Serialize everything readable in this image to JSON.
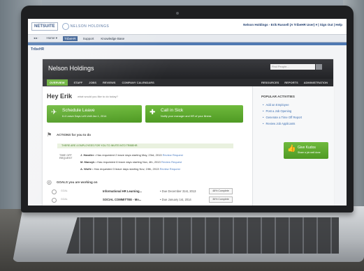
{
  "topbar": {
    "netsuite_logo": "NETSUITE",
    "company_logo": "NELSON HOLDINGS",
    "user_links": "Nelson Holdings - Erik Russell (A TribeHR User) ▾ | Sign Out | Help"
  },
  "navbar": {
    "items": [
      {
        "label": "◂ ▸ ·"
      },
      {
        "label": "Home ▾"
      },
      {
        "label": "TribeHR"
      },
      {
        "label": "Support"
      },
      {
        "label": "Knowledge Base"
      }
    ]
  },
  "breadcrumb": "TribeHR",
  "portal": {
    "company_name": "Nelson Holdings",
    "find_placeholder": "Find People...",
    "tabs": [
      "OVERVIEW",
      "STAFF",
      "JOBS",
      "REVIEWS",
      "COMPANY CALENDARS"
    ],
    "right_tabs": [
      "RESOURCES",
      "REPORTS",
      "ADMINISTRATION"
    ]
  },
  "main": {
    "greeting": "Hey Erik",
    "greeting_sub": "what would you like to do today?",
    "schedule_leave": {
      "title": "Schedule Leave",
      "subtitle": "6.4 Leave Days Left Until Jan 1, 2014",
      "icon": "airplane-icon"
    },
    "call_in_sick": {
      "title": "Call in Sick",
      "subtitle": "Notify your manager and HR of your illness",
      "icon": "medical-icon"
    },
    "actions_title": "ACTIONS for you to do",
    "notice": "THERE ARE 4 EMPLOYEES FOR YOU TO INVITE INTO TRIBEHR.",
    "timeoff_label": "TIME OFF REQUEST",
    "requests": [
      {
        "name": "J. Handler",
        "text": "• Has requested 2 leave days starting May, 23rd, 2013",
        "link": "Review Request"
      },
      {
        "name": "M. Manoyk",
        "text": "• Has requested 6 leave days starting Nov, 4th, 2013",
        "link": "Review Request"
      },
      {
        "name": "A. Wolfe",
        "text": "• Has requested 3 leave days starting Nov, 19th, 2013",
        "link": "Review Request"
      }
    ],
    "goals_title": "GOALS you are working on",
    "goals": [
      {
        "label": "GOAL",
        "title": "Informational HR Learning...",
        "due": "• Due December 31st, 2013",
        "pct": "48% Complete"
      },
      {
        "label": "GOAL",
        "title": "SOCIAL COMMITTEE - Mo...",
        "due": "• Due January 1st, 2014",
        "pct": "36% Complete"
      }
    ]
  },
  "sidebar": {
    "popular_title": "POPULAR ACTIVITIES",
    "items": [
      "Add an Employee",
      "Post a Job Opening",
      "Generate a Time Off Report",
      "Review Job Applicants"
    ],
    "kudos": {
      "title": "Give Kudos",
      "subtitle": "Share a job well done",
      "icon": "thumbs-up-icon"
    }
  }
}
